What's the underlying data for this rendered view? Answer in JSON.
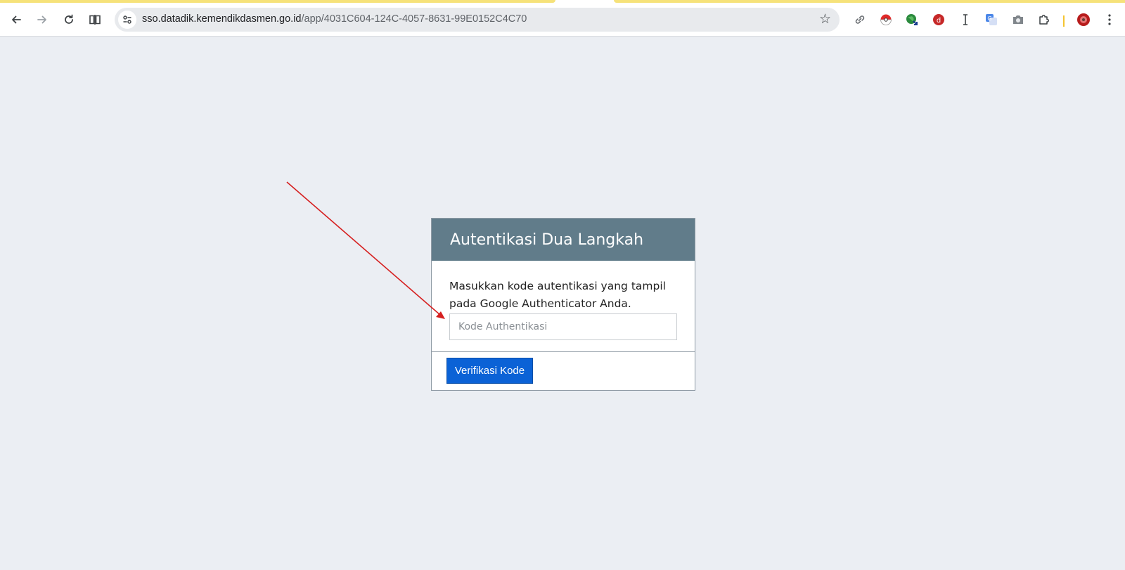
{
  "browser": {
    "url_host": "sso.datadik.kemendikdasmen.go.id",
    "url_path": "/app/4031C604-124C-4057-8631-99E0152C4C70",
    "nav_icons": [
      "back-arrow-icon",
      "forward-arrow-icon",
      "reload-icon",
      "split-view-icon"
    ],
    "extension_icons": [
      "link-icon",
      "pokeball-icon",
      "globe-download-icon",
      "red-circle-extension-icon",
      "text-cursor-icon",
      "translate-icon",
      "camera-icon",
      "puzzle-extensions-icon"
    ],
    "profile_icon": "profile-avatar-icon",
    "menu_icon": "kebab-menu-icon"
  },
  "card": {
    "title": "Autentikasi Dua Langkah",
    "instruction": "Masukkan kode autentikasi yang tampil pada Google Authenticator Anda.",
    "input_placeholder": "Kode Authentikasi",
    "input_value": "",
    "button_label": "Verifikasi Kode"
  },
  "colors": {
    "page_bg": "#ebeef3",
    "header_bg": "#617c8a",
    "button_bg": "#0b62d6",
    "annotation_arrow": "#d62020"
  }
}
